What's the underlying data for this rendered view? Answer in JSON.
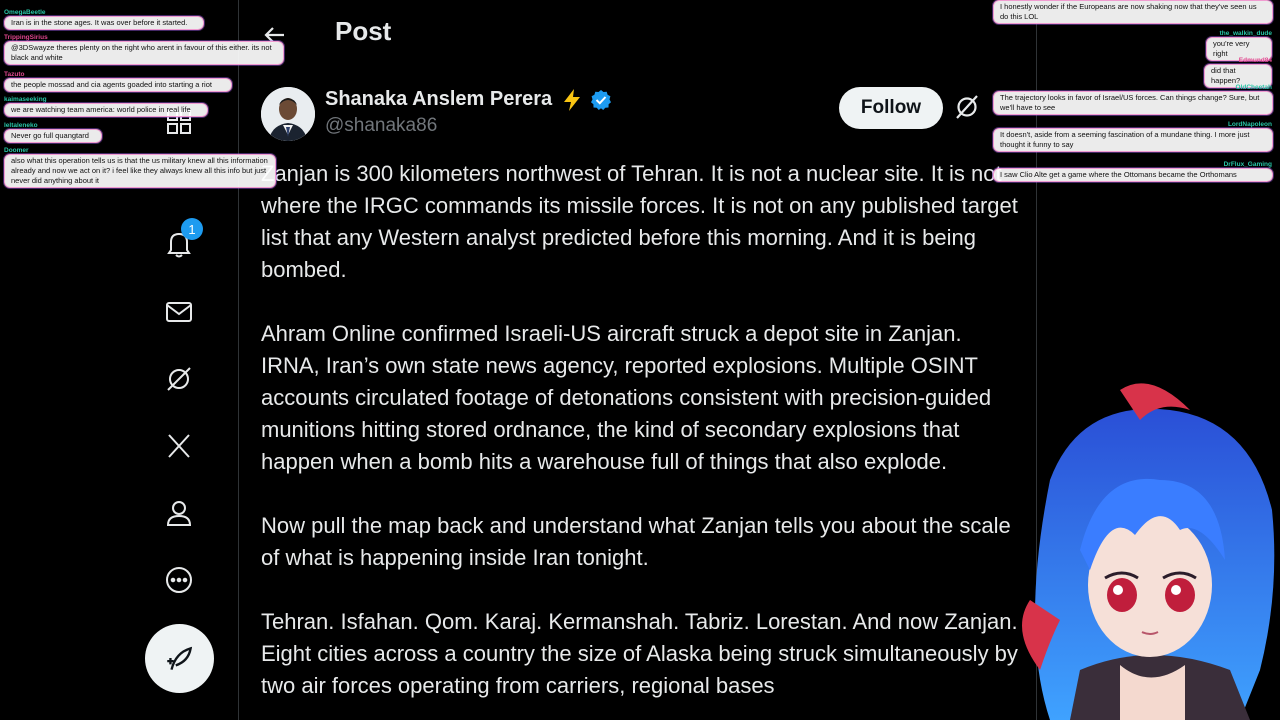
{
  "header": {
    "title": "Post"
  },
  "nav": {
    "notification_count": "1"
  },
  "author": {
    "name": "Shanaka Anslem Perera",
    "handle": "@shanaka86",
    "follow_label": "Follow"
  },
  "post": {
    "paragraphs": [
      "Zanjan is 300 kilometers northwest of Tehran. It is not a nuclear site. It is not where the IRGC commands its missile forces. It is not on any published target list that any Western analyst predicted before this morning. And it is being bombed.",
      "Ahram Online confirmed Israeli-US aircraft struck a depot site in Zanjan. IRNA, Iran’s own state news agency, reported explosions. Multiple OSINT accounts circulated footage of detonations consistent with precision-guided munitions hitting stored ordnance, the kind of secondary explosions that happen when a bomb hits a warehouse full of things that also explode.",
      "Now pull the map back and understand what Zanjan tells you about the scale of what is happening inside Iran tonight.",
      "Tehran. Isfahan. Qom. Karaj. Kermanshah. Tabriz. Lorestan. And now Zanjan. Eight cities across a country the size of Alaska being struck simultaneously by two air forces operating from carriers, regional bases"
    ]
  },
  "chat_left": [
    {
      "user": "OmegaBeetle",
      "text": "Iran is in the stone ages. It was over before it started."
    },
    {
      "user": "TrippingSirius",
      "text": "@3DSwayze theres plenty on the right who arent in favour of this either. its not black and white"
    },
    {
      "user": "Tazuto",
      "text": "the people mossad and cia agents goaded into starting a riot"
    },
    {
      "user": "kaimaseeking",
      "text": "we are watching team america: world police in real life"
    },
    {
      "user": "leltaleneko",
      "text": "Never go full quangtard"
    },
    {
      "user": "Doomer",
      "text": "also what this operation tells us is that the us military knew all this information already and now we act on it? i feel like they always knew all this info but just never did anything about it"
    }
  ],
  "chat_right": [
    {
      "user": "",
      "text": "I honestly wonder if the Europeans are now shaking now that they've seen us do this LOL"
    },
    {
      "user": "the_walkin_dude",
      "text": "you're very right"
    },
    {
      "user": "Edmund84",
      "text": "did that happen?"
    },
    {
      "user": "OldCheetah",
      "text": "The trajectory looks in favor of Israel/US forces. Can things change? Sure, but we'll have to see"
    },
    {
      "user": "LordNapoleon",
      "text": "It doesn't, aside from a seeming fascination of a mundane thing. I more just thought it funny to say"
    },
    {
      "user": "DrFlux_Gaming",
      "text": "I saw Clio Alte get a game where the Ottomans became the Orthomans"
    }
  ]
}
